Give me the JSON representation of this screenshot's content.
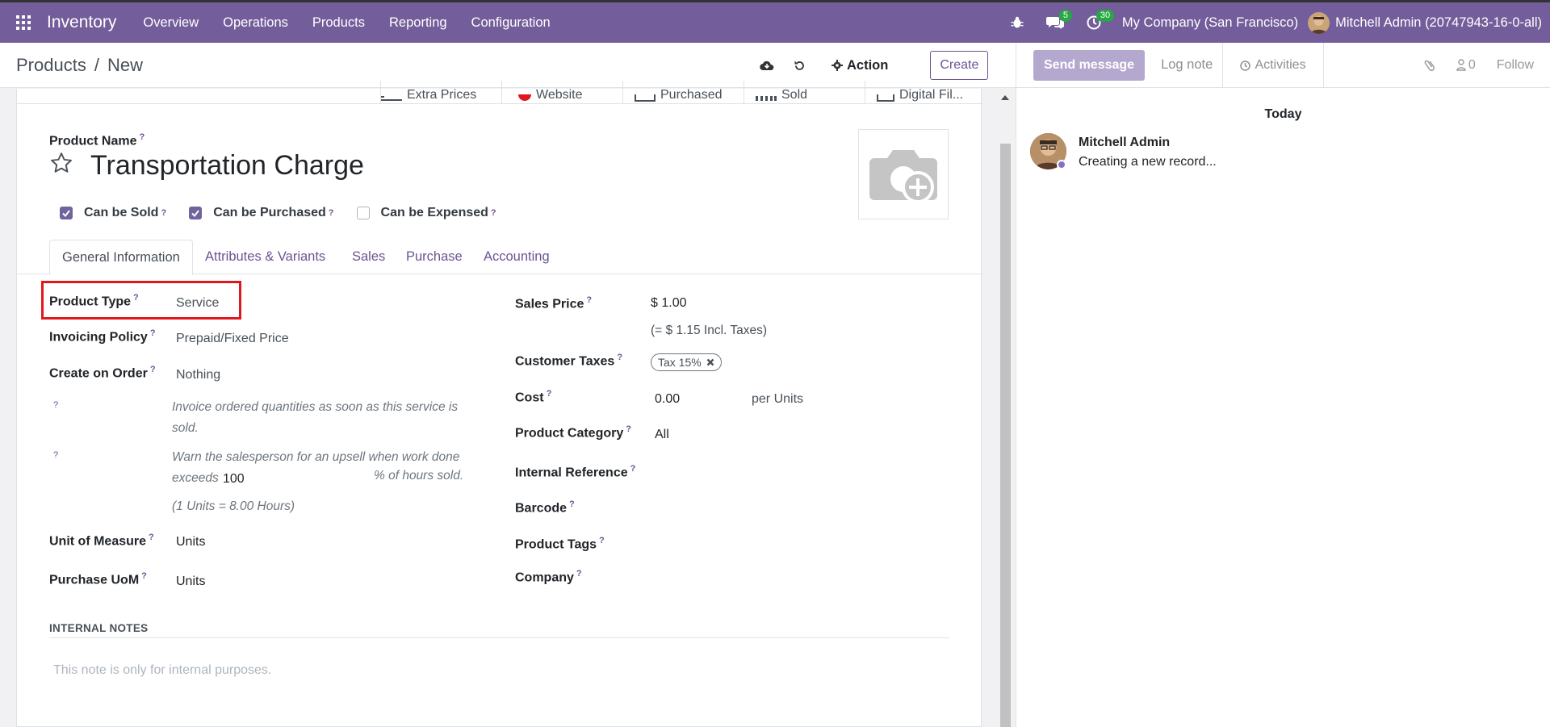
{
  "navbar": {
    "app_name": "Inventory",
    "menu": [
      "Overview",
      "Operations",
      "Products",
      "Reporting",
      "Configuration"
    ],
    "messages_count": "5",
    "activities_count": "30",
    "company": "My Company (San Francisco)",
    "user": "Mitchell Admin (20747943-16-0-all)"
  },
  "control": {
    "breadcrumb_parent": "Products",
    "breadcrumb_separator": "/",
    "breadcrumb_current": "New",
    "action_label": "Action",
    "create_label": "Create"
  },
  "smart_buttons": [
    "Extra Prices",
    "Website",
    "Purchased",
    "Sold",
    "Digital Fil..."
  ],
  "form": {
    "product_name_label": "Product Name",
    "product_name": "Transportation Charge",
    "can_be_sold": "Can be Sold",
    "can_be_purchased": "Can be Purchased",
    "can_be_expensed": "Can be Expensed",
    "tabs": [
      "General Information",
      "Attributes & Variants",
      "Sales",
      "Purchase",
      "Accounting"
    ],
    "left": {
      "product_type_label": "Product Type",
      "product_type": "Service",
      "invoicing_policy_label": "Invoicing Policy",
      "invoicing_policy": "Prepaid/Fixed Price",
      "create_on_order_label": "Create on Order",
      "create_on_order": "Nothing",
      "help1": "Invoice ordered quantities as soon as this service is sold.",
      "help2_a": "Warn the salesperson for an upsell when work done",
      "help2_b": "exceeds",
      "help2_value": "100",
      "help2_c": "% of hours sold.",
      "help3": "(1 Units = 8.00 Hours)",
      "uom_label": "Unit of Measure",
      "uom": "Units",
      "purchase_uom_label": "Purchase UoM",
      "purchase_uom": "Units"
    },
    "right": {
      "sales_price_label": "Sales Price",
      "sales_price": "$ 1.00",
      "incl_taxes": "(= $ 1.15 Incl. Taxes)",
      "customer_taxes_label": "Customer Taxes",
      "tax_tag": "Tax 15%",
      "cost_label": "Cost",
      "cost": "0.00",
      "cost_unit": "per Units",
      "category_label": "Product Category",
      "category": "All",
      "internal_ref_label": "Internal Reference",
      "barcode_label": "Barcode",
      "tags_label": "Product Tags",
      "company_label": "Company"
    },
    "internal_notes_title": "INTERNAL NOTES",
    "internal_notes_placeholder": "This note is only for internal purposes."
  },
  "chatter": {
    "send_message": "Send message",
    "log_note": "Log note",
    "activities": "Activities",
    "followers_count": "0",
    "follow": "Follow",
    "today": "Today",
    "author": "Mitchell Admin",
    "message": "Creating a new record..."
  },
  "colors": {
    "navbar": "#735d9a",
    "accent": "#6c5392",
    "highlight": "#e0171f"
  }
}
